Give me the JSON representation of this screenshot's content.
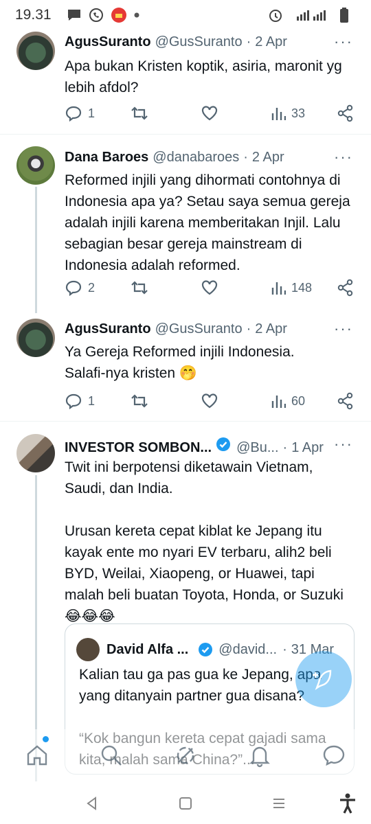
{
  "status": {
    "time": "19.31",
    "network": "LTE"
  },
  "tweets": [
    {
      "name": "AgusSuranto",
      "handle": "@GusSuranto",
      "date": "2 Apr",
      "text": "Apa bukan Kristen koptik, asiria, maronit yg\nlebih afdol?",
      "replies": "1",
      "views": "33"
    },
    {
      "name": "Dana Baroes",
      "handle": "@danabaroes",
      "date": "2 Apr",
      "text": "Reformed injili yang dihormati contohnya di\nIndonesia apa ya? Setau saya semua gereja\nadalah injili karena memberitakan Injil. Lalu\nsebagian besar gereja mainstream di\nIndonesia adalah reformed.",
      "replies": "2",
      "views": "148"
    },
    {
      "name": "AgusSuranto",
      "handle": "@GusSuranto",
      "date": "2 Apr",
      "text": "Ya Gereja Reformed injili Indonesia.\nSalafi-nya kristen 🤭",
      "replies": "1",
      "views": "60"
    },
    {
      "name": "INVESTOR SOMBON...",
      "handle": "@Bu...",
      "date": "1 Apr",
      "text": "Twit ini berpotensi diketawain Vietnam,\nSaudi, dan India.\n\nUrusan kereta cepat kiblat ke Jepang itu\nkayak ente mo nyari EV terbaru, alih2 beli\nBYD, Weilai, Xiaopeng, or Huawei, tapi\nmalah beli buatan Toyota, Honda, or Suzuki\n😂😂😂"
    }
  ],
  "quote": {
    "name": "David Alfa ...",
    "handle": "@david...",
    "date": "31 Mar",
    "text": "Kalian tau ga pas gua ke Jepang, apa\nyang ditanyain partner gua disana?\n\n“Kok bangun kereta cepat gajadi sama\nkita, malah sama China?”..."
  },
  "colors": {
    "accent": "#1d9bf0",
    "text": "#0f1419",
    "secondary": "#536471",
    "border": "#cfd9de"
  },
  "icons": {
    "reply": "speech-bubble-icon",
    "retweet": "retweet-icon",
    "like": "heart-icon",
    "views": "bar-chart-icon",
    "share": "share-icon",
    "compose": "feather-plus-icon"
  }
}
